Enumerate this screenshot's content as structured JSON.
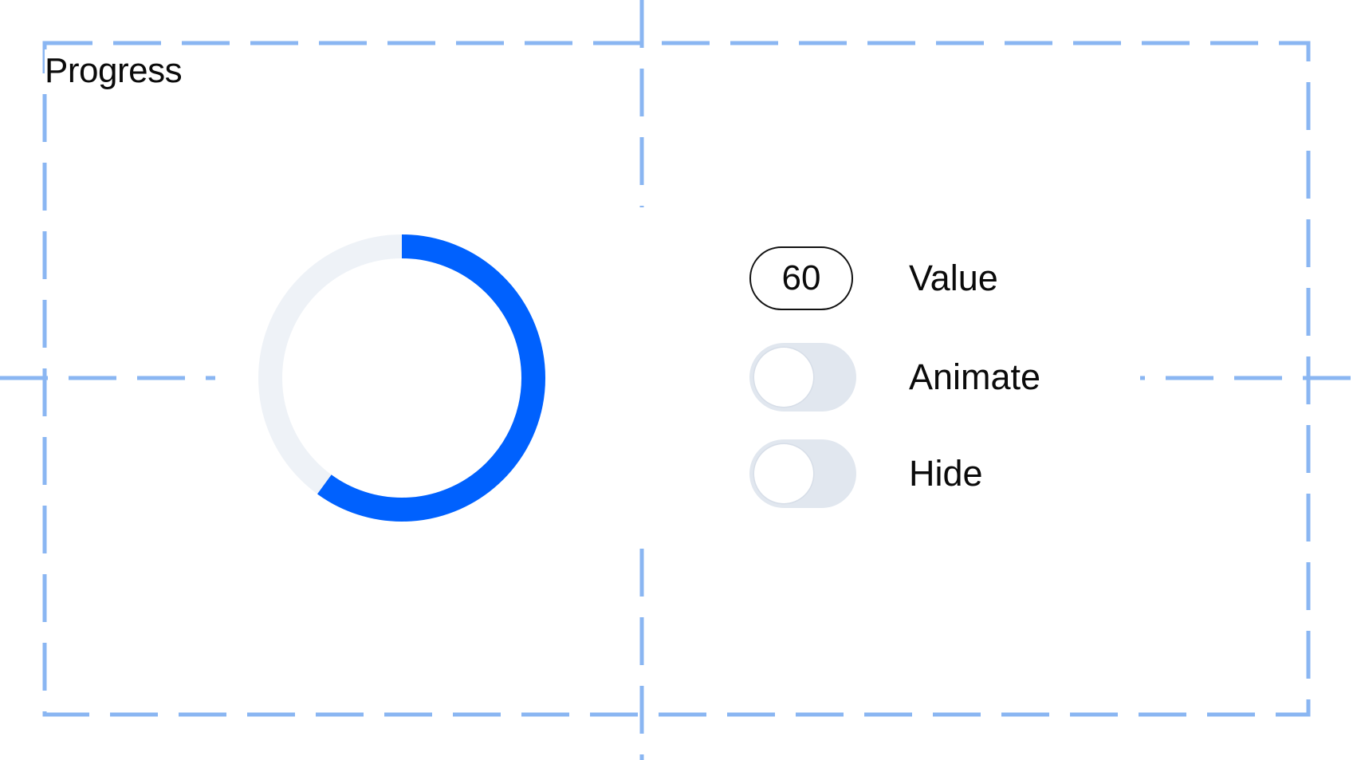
{
  "panel": {
    "title": "Progress"
  },
  "progress": {
    "value": 60,
    "max": 100,
    "track_color": "#eef2f7",
    "fill_color": "#0061fe"
  },
  "controls": {
    "value": {
      "label": "Value",
      "input_value": "60"
    },
    "animate": {
      "label": "Animate",
      "checked": false
    },
    "hide": {
      "label": "Hide",
      "checked": false
    }
  },
  "colors": {
    "guide": "#8ab6f2",
    "text": "#0b0b0b",
    "toggle_off": "#e1e7ef"
  }
}
